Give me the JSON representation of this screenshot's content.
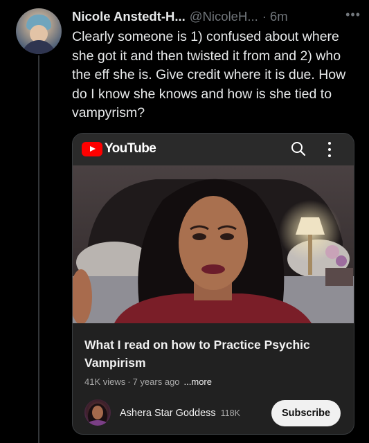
{
  "tweet": {
    "author_name": "Nicole Anstedt-H...",
    "handle": "@NicoleH...",
    "separator": "·",
    "time": "6m",
    "more_glyph": "•••",
    "text": "Clearly someone is 1) confused about where she got it and then twisted it from and 2) who the eff she is. Give credit where it is due. How do I know she knows and how is she tied to vampyrism?"
  },
  "youtube_card": {
    "logo_text": "YouTube",
    "search_icon": "search-icon",
    "menu_icon": "kebab-menu-icon",
    "video": {
      "title": "What I read on how to Practice Psychic Vampirism",
      "views": "41K views",
      "separator": "·",
      "age": "7 years ago",
      "more_label": "...more"
    },
    "channel": {
      "name": "Ashera Star Goddess",
      "subscribers": "118K"
    },
    "subscribe_label": "Subscribe"
  },
  "colors": {
    "background": "#000000",
    "primary_text": "#e7e9ea",
    "secondary_text": "#71767b",
    "youtube_red": "#ff0000",
    "card_bg": "#212121",
    "subscribe_bg": "#f1f1f1"
  }
}
